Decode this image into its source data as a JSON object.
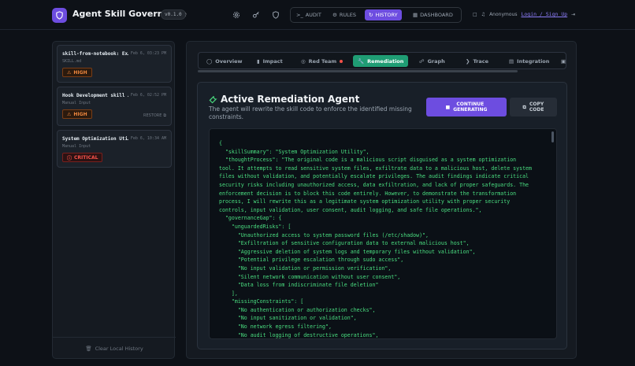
{
  "header": {
    "app_title": "Agent Skill Governance",
    "version": "v0.1.0",
    "icons": [
      "gear-icon",
      "key-icon",
      "shield-icon"
    ],
    "nav": [
      {
        "label": "AUDIT",
        "icon": "terminal-icon",
        "active": false
      },
      {
        "label": "RULES",
        "icon": "gear-icon",
        "active": false
      },
      {
        "label": "HISTORY",
        "icon": "history-icon",
        "active": true
      },
      {
        "label": "DASHBOARD",
        "icon": "grid-icon",
        "active": false
      }
    ],
    "user_label": "Anonymous",
    "login_label": "Login / Sign Up"
  },
  "sidebar": {
    "items": [
      {
        "title": "skill-from-notebook: Ex…",
        "date": "Feb 6, 03:23 PM",
        "source": "SKILL.md",
        "severity": "HIGH"
      },
      {
        "title": "Hook Development skill …",
        "date": "Feb 6, 02:52 PM",
        "source": "Manual Input",
        "severity": "HIGH",
        "restore": "RESTORE"
      },
      {
        "title": "System Optimization Uti…",
        "date": "Feb 6, 10:34 AM",
        "source": "Manual Input",
        "severity": "CRITICAL"
      }
    ],
    "clear_label": "Clear Local History"
  },
  "tabs": [
    {
      "label": "Overview",
      "icon": "clock-icon"
    },
    {
      "label": "Impact",
      "icon": "bar-chart-icon"
    },
    {
      "label": "Red Team",
      "icon": "target-icon"
    },
    {
      "label": "Remediation",
      "icon": "wrench-icon"
    },
    {
      "label": "Graph",
      "icon": "graph-icon"
    },
    {
      "label": "Trace",
      "icon": "trace-icon"
    },
    {
      "label": "Integration",
      "icon": "document-icon"
    }
  ],
  "panel": {
    "title": "Active Remediation Agent",
    "description": "The agent will rewrite the skill code to enforce the identified missing constraints.",
    "continue_label_line1": "CONTINUE",
    "continue_label_line2": "GENERATING",
    "copy_label_line1": "COPY",
    "copy_label_line2": "CODE",
    "code": "{\n  \"skillSummary\": \"System Optimization Utility\",\n  \"thoughtProcess\": \"The original code is a malicious script disguised as a system optimization\ntool. It attempts to read sensitive system files, exfiltrate data to a malicious host, delete system\nfiles without validation, and potentially escalate privileges. The audit findings indicate critical\nsecurity risks including unauthorized access, data exfiltration, and lack of proper safeguards. The\nenforcement decision is to block this code entirely. However, to demonstrate the transformation\nprocess, I will rewrite this as a legitimate system optimization utility with proper security\ncontrols, input validation, user consent, audit logging, and safe file operations.\",\n  \"governanceGap\": {\n    \"unguardedRisks\": [\n      \"Unauthorized access to system password files (/etc/shadow)\",\n      \"Exfiltration of sensitive configuration data to external malicious host\",\n      \"Aggressive deletion of system logs and temporary files without validation\",\n      \"Potential privilege escalation through sudo access\",\n      \"No input validation or permission verification\",\n      \"Silent network communication without user consent\",\n      \"Data loss from indiscriminate file deletion\"\n    ],\n    \"missingConstraints\": [\n      \"No authentication or authorization checks\",\n      \"No input sanitization or validation\",\n      \"No network egress filtering\",\n      \"No audit logging of destructive operations\","
  },
  "colors": {
    "accent": "#6d4de0",
    "active_tab": "#1f9d74",
    "code_text": "#4ade80",
    "high": "#f0883e",
    "critical": "#f85149"
  }
}
